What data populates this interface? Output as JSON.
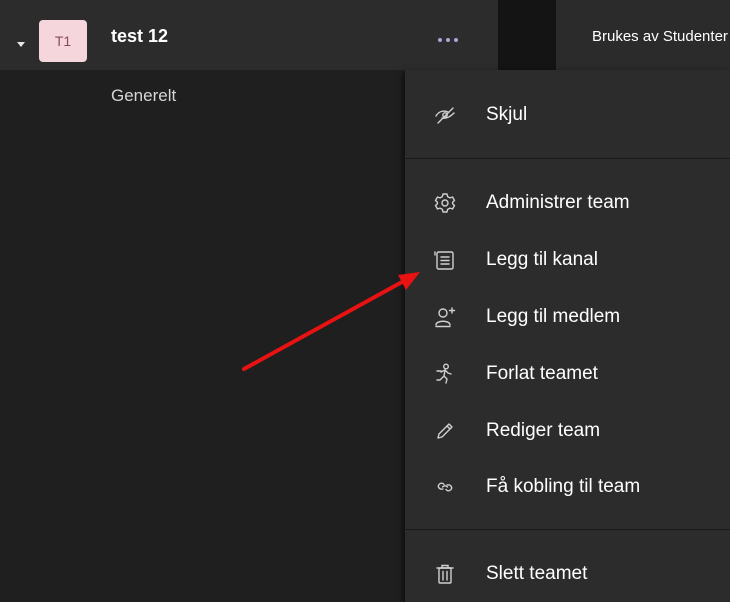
{
  "team": {
    "avatar_initials": "T1",
    "name": "test 12",
    "channel": "Generelt"
  },
  "top_bar": {
    "text": "Brukes av Studenter"
  },
  "menu": {
    "items": [
      {
        "label": "Skjul",
        "icon": "hide-icon"
      },
      {
        "label": "Administrer team",
        "icon": "gear-icon"
      },
      {
        "label": "Legg til kanal",
        "icon": "channel-icon"
      },
      {
        "label": "Legg til medlem",
        "icon": "add-member-icon"
      },
      {
        "label": "Forlat teamet",
        "icon": "leave-icon"
      },
      {
        "label": "Rediger team",
        "icon": "pencil-icon"
      },
      {
        "label": "Få kobling til team",
        "icon": "link-icon"
      },
      {
        "label": "Slett teamet",
        "icon": "trash-icon"
      }
    ]
  },
  "colors": {
    "background": "#1f1f1f",
    "panel": "#2d2c2c",
    "avatar_bg": "#f5d6dc",
    "accent": "#a6a7dc",
    "arrow": "#e81212"
  }
}
